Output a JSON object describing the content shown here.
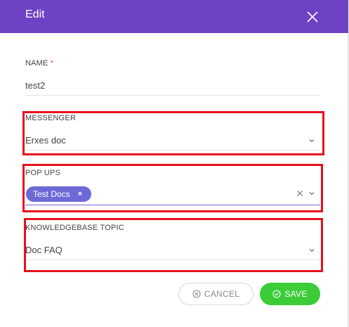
{
  "dialog": {
    "title": "Edit"
  },
  "fields": {
    "name": {
      "label": "NAME",
      "required_mark": "*",
      "value": "test2"
    },
    "messenger": {
      "label": "MESSENGER",
      "value": "Erxes doc"
    },
    "popups": {
      "label": "POP UPS",
      "tags": [
        "Test Docs"
      ],
      "tag_remove": "×"
    },
    "knowledgebase_topic": {
      "label": "KNOWLEDGEBASE TOPIC",
      "value": "Doc FAQ"
    }
  },
  "actions": {
    "cancel_label": "CANCEL",
    "save_label": "SAVE"
  },
  "colors": {
    "header": "#6d42c4",
    "tag": "#6d6ad8",
    "save": "#3ccc38",
    "highlight": "#e8101e",
    "required": "#ea475d"
  },
  "icons": {
    "close": "close-icon",
    "chevron": "chevron-down-icon",
    "clear": "clear-icon",
    "cancel": "cancel-circle-icon",
    "save": "check-circle-icon"
  }
}
